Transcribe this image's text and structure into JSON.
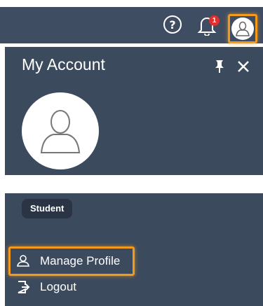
{
  "topbar": {
    "notification_count": "1",
    "icons": [
      "help-icon",
      "bell-icon",
      "user-avatar-icon"
    ]
  },
  "account_panel": {
    "title": "My Account"
  },
  "profile_menu": {
    "role_badge": "Student",
    "items": [
      {
        "label": "Manage Profile",
        "icon": "user-profile-icon"
      },
      {
        "label": "Logout",
        "icon": "logout-icon"
      }
    ]
  },
  "colors": {
    "header_bg": "#3f4d63",
    "panel_bg": "#3c4a5e",
    "highlight": "#f29a1d",
    "badge_red": "#e02f2f"
  }
}
